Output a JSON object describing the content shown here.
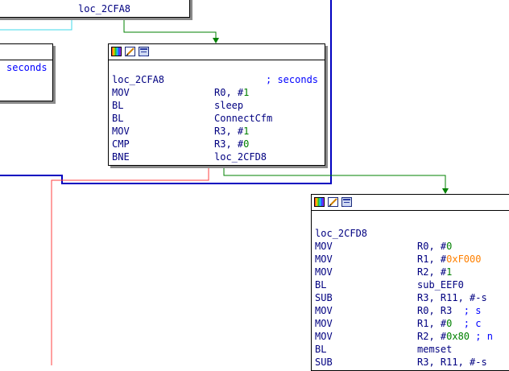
{
  "colors": {
    "edge_blue": "#0000c0",
    "edge_green": "#008000",
    "edge_red": "#ff4040",
    "edge_cyan": "#40d8e8",
    "text_navy": "#000080",
    "number_green": "#008000",
    "hex_orange": "#ff8000"
  },
  "header_icons": [
    "palette-icon",
    "edit-icon",
    "graph-icon"
  ],
  "top_node": {
    "label": "loc_2CFA8"
  },
  "left_node": {
    "comment": "seconds"
  },
  "node_2CFA8": {
    "label": "loc_2CFA8",
    "label_comment": "; seconds",
    "rows": [
      {
        "mnemonic": "MOV",
        "op1": "R0, #",
        "num": "1",
        "op_rest": ""
      },
      {
        "mnemonic": "BL",
        "op1": "sleep",
        "num": "",
        "op_rest": ""
      },
      {
        "mnemonic": "BL",
        "op1": "ConnectCfm",
        "num": "",
        "op_rest": ""
      },
      {
        "mnemonic": "MOV",
        "op1": "R3, #",
        "num": "1",
        "op_rest": ""
      },
      {
        "mnemonic": "CMP",
        "op1": "R3, #",
        "num": "0",
        "op_rest": ""
      },
      {
        "mnemonic": "BNE",
        "op1": "loc_2CFD8",
        "num": "",
        "op_rest": ""
      }
    ]
  },
  "node_2CFD8": {
    "label": "loc_2CFD8",
    "rows": [
      {
        "mnemonic": "MOV",
        "op1": "R0, #",
        "num": "0",
        "op_rest": ""
      },
      {
        "mnemonic": "MOV",
        "op1": "R1, #",
        "hex": "0xF000",
        "op_rest": ""
      },
      {
        "mnemonic": "MOV",
        "op1": "R2, #",
        "num": "1",
        "op_rest": ""
      },
      {
        "mnemonic": "BL",
        "op1": "sub_EEF0",
        "num": "",
        "op_rest": ""
      },
      {
        "mnemonic": "SUB",
        "op1": "R3, R11, #-s",
        "num": "",
        "op_rest": ""
      },
      {
        "mnemonic": "MOV",
        "op1": "R0, R3",
        "num": "",
        "op_rest": "  ; s"
      },
      {
        "mnemonic": "MOV",
        "op1": "R1, #",
        "num": "0",
        "op_rest": "  ; c"
      },
      {
        "mnemonic": "MOV",
        "op1": "R2, #",
        "num": "0x80",
        "op_rest": " ; n"
      },
      {
        "mnemonic": "BL",
        "op1": "memset",
        "num": "",
        "op_rest": ""
      },
      {
        "mnemonic": "SUB",
        "op1": "R3, R11, #-s",
        "num": "",
        "op_rest": ""
      }
    ]
  }
}
